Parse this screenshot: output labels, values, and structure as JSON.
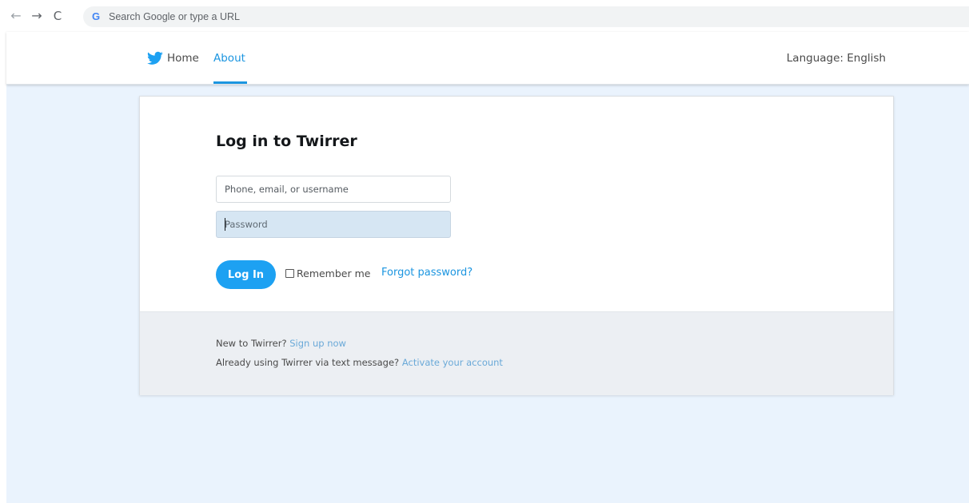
{
  "browser": {
    "back_icon": "←",
    "forward_icon": "→",
    "reload_icon": "C",
    "omnibox_logo": "G",
    "omnibox_placeholder": "Search Google or type a URL"
  },
  "nav": {
    "home_label": "Home",
    "about_label": "About",
    "language_label": "Language: English",
    "brand_icon": "bird-icon",
    "active_color": "#1b95e0"
  },
  "login": {
    "title": "Log in to Twirrer",
    "username_placeholder": "Phone, email, or username",
    "password_placeholder": "Password",
    "login_button": "Log In",
    "remember_label": "Remember me",
    "forgot_label": "Forgot password?",
    "accent_color": "#1da1f2"
  },
  "footer": {
    "signup_prefix": "New to Twirrer? ",
    "signup_link": "Sign up now",
    "activate_prefix": "Already using Twirrer via text message? ",
    "activate_link": "Activate your account"
  }
}
